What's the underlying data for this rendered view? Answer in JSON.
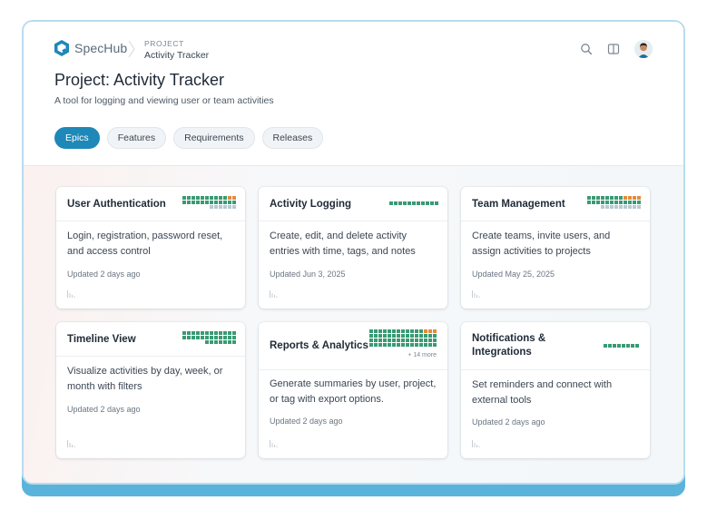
{
  "app": {
    "name": "SpecHub"
  },
  "breadcrumb": {
    "section": "PROJECT",
    "current": "Activity Tracker"
  },
  "header_icons": [
    "search-icon",
    "columns-icon",
    "user-avatar"
  ],
  "page": {
    "title": "Project: Activity Tracker",
    "subtitle": "A tool for logging and viewing user or team activities"
  },
  "tabs": [
    {
      "label": "Epics",
      "active": true
    },
    {
      "label": "Features",
      "active": false
    },
    {
      "label": "Requirements",
      "active": false
    },
    {
      "label": "Releases",
      "active": false
    }
  ],
  "colors": {
    "accent": "#1e88b8",
    "done": "#3a9a74",
    "in_progress": "#e48b3a",
    "todo": "#b9c8d2",
    "base_bar": "#5ab3db"
  },
  "cards": [
    {
      "title": "User Authentication",
      "description": "Login, registration, password reset, and access control",
      "updated": "Updated 2 days ago",
      "status_cells": [
        "o",
        "o",
        "g",
        "g",
        "g",
        "g",
        "g",
        "g",
        "g",
        "g",
        "g",
        "g",
        "g",
        "g",
        "g",
        "g",
        "g",
        "g",
        "g",
        "g",
        "g",
        "g",
        "g",
        "g",
        "t",
        "t",
        "t",
        "t",
        "t",
        "t"
      ]
    },
    {
      "title": "Activity Logging",
      "description": "Create, edit, and delete activity entries with time, tags, and notes",
      "updated": "Updated Jun 3, 2025",
      "status_cells": [
        "g",
        "g",
        "g",
        "g",
        "g",
        "g",
        "g",
        "g",
        "g",
        "g",
        "g"
      ]
    },
    {
      "title": "Team Management",
      "description": "Create teams, invite users, and assign activities to projects",
      "updated": "Updated May 25, 2025",
      "status_cells": [
        "o",
        "o",
        "o",
        "o",
        "g",
        "g",
        "g",
        "g",
        "g",
        "g",
        "g",
        "g",
        "g",
        "g",
        "g",
        "g",
        "g",
        "g",
        "g",
        "g",
        "g",
        "g",
        "g",
        "g",
        "t",
        "t",
        "t",
        "t",
        "t",
        "t",
        "t",
        "t",
        "t"
      ]
    },
    {
      "title": "Timeline View",
      "description": "Visualize activities by day, week, or month with filters",
      "updated": "Updated 2 days ago",
      "status_cells": [
        "g",
        "g",
        "g",
        "g",
        "g",
        "g",
        "g",
        "g",
        "g",
        "g",
        "g",
        "g",
        "g",
        "g",
        "g",
        "g",
        "g",
        "g",
        "g",
        "g",
        "g",
        "g",
        "g",
        "g",
        "g",
        "g",
        "g",
        "g",
        "g",
        "g",
        "g"
      ]
    },
    {
      "title": "Reports & Analytics",
      "description": "Generate summaries by user, project, or tag with export options.",
      "updated": "Updated 2 days ago",
      "more": "+ 14 more",
      "status_cells": [
        "o",
        "o",
        "o",
        "g",
        "g",
        "g",
        "g",
        "g",
        "g",
        "g",
        "g",
        "g",
        "g",
        "g",
        "g",
        "g",
        "g",
        "g",
        "g",
        "g",
        "g",
        "g",
        "g",
        "g",
        "g",
        "g",
        "g",
        "g",
        "g",
        "g",
        "g",
        "g",
        "g",
        "g",
        "g",
        "g",
        "g",
        "g",
        "g",
        "g",
        "g",
        "g",
        "g",
        "g",
        "g",
        "g",
        "g",
        "g",
        "g",
        "g",
        "g",
        "g",
        "g",
        "g",
        "g",
        "g",
        "g",
        "g",
        "g",
        "g"
      ]
    },
    {
      "title": "Notifications & Integrations",
      "description": "Set reminders and connect with external tools",
      "updated": "Updated 2 days ago",
      "status_cells": [
        "g",
        "g",
        "g",
        "g",
        "g",
        "g",
        "g",
        "g"
      ]
    }
  ]
}
